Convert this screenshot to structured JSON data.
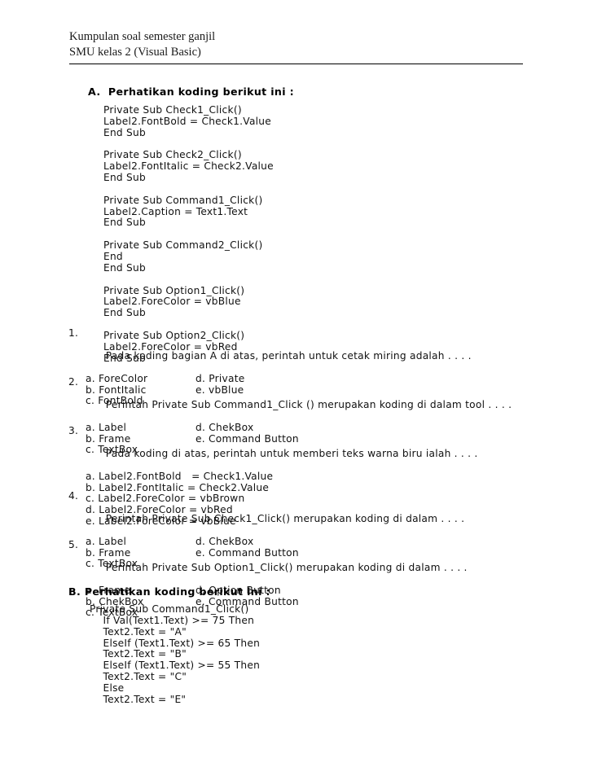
{
  "header": {
    "line1": "Kumpulan soal semester ganjil",
    "line2": "SMU kelas 2 (Visual Basic)"
  },
  "section_a": {
    "heading": "A.  Perhatikan koding berikut ini :",
    "code": "Private Sub Check1_Click()\nLabel2.FontBold = Check1.Value\nEnd Sub\n\nPrivate Sub Check2_Click()\nLabel2.FontItalic = Check2.Value\nEnd Sub\n\nPrivate Sub Command1_Click()\nLabel2.Caption = Text1.Text\nEnd Sub\n\nPrivate Sub Command2_Click()\nEnd\nEnd Sub\n\nPrivate Sub Option1_Click()\nLabel2.ForeColor = vbBlue\nEnd Sub\n\nPrivate Sub Option2_Click()\nLabel2.ForeColor = vbRed\nEnd Sub"
  },
  "questions": [
    {
      "number": "1.",
      "stem": "Pada koding bagian A di atas, perintah untuk cetak miring adalah . . . .",
      "layout": "two-column",
      "rows": [
        {
          "left": "a. ForeColor",
          "right": "d. Private"
        },
        {
          "left": "b. FontItalic",
          "right": "e. vbBlue"
        },
        {
          "left": "c. FontBold",
          "right": ""
        }
      ]
    },
    {
      "number": "2.",
      "stem": "Perintah Private Sub Command1_Click () merupakan koding di dalam tool . . . .",
      "layout": "two-column",
      "rows": [
        {
          "left": "a. Label",
          "right": "d. ChekBox"
        },
        {
          "left": "b. Frame",
          "right": "e. Command Button"
        },
        {
          "left": "c. TextBox",
          "right": ""
        }
      ]
    },
    {
      "number": "3.",
      "stem": "Pada koding di atas, perintah untuk memberi teks warna biru ialah . . . .",
      "layout": "stack",
      "rows": [
        {
          "left": "a. Label2.FontBold   = Check1.Value",
          "right": ""
        },
        {
          "left": "b. Label2.FontItalic = Check2.Value",
          "right": ""
        },
        {
          "left": "c. Label2.ForeColor = vbBrown",
          "right": ""
        },
        {
          "left": "d. Label2.ForeColor = vbRed",
          "right": ""
        },
        {
          "left": "e. Label2.ForeColor = vbBlue",
          "right": ""
        }
      ]
    },
    {
      "number": "4.",
      "stem": "Perintah Private Sub Check1_Click() merupakan koding di dalam . . . .",
      "layout": "two-column",
      "rows": [
        {
          "left": "a. Label",
          "right": "d. ChekBox"
        },
        {
          "left": "b. Frame",
          "right": "e. Command Button"
        },
        {
          "left": "c. TextBox",
          "right": ""
        }
      ]
    },
    {
      "number": "5.",
      "stem": "Perintah Private Sub Option1_Click() merupakan koding di dalam . . . .",
      "layout": "two-column",
      "rows": [
        {
          "left": "a. Frame",
          "right": "d. Option Button"
        },
        {
          "left": "b. ChekBox",
          "right": "e. Command Button"
        },
        {
          "left": "c. TextBox",
          "right": ""
        }
      ]
    }
  ],
  "section_b": {
    "heading": "B. Perhatikan koding berikut ini :",
    "code": "Private Sub Command1_Click()\n    If Val(Text1.Text) >= 75 Then\n    Text2.Text = \"A\"\n    ElseIf (Text1.Text) >= 65 Then\n    Text2.Text = \"B\"\n    ElseIf (Text1.Text) >= 55 Then\n    Text2.Text = \"C\"\n    Else\n    Text2.Text = \"E\""
  }
}
